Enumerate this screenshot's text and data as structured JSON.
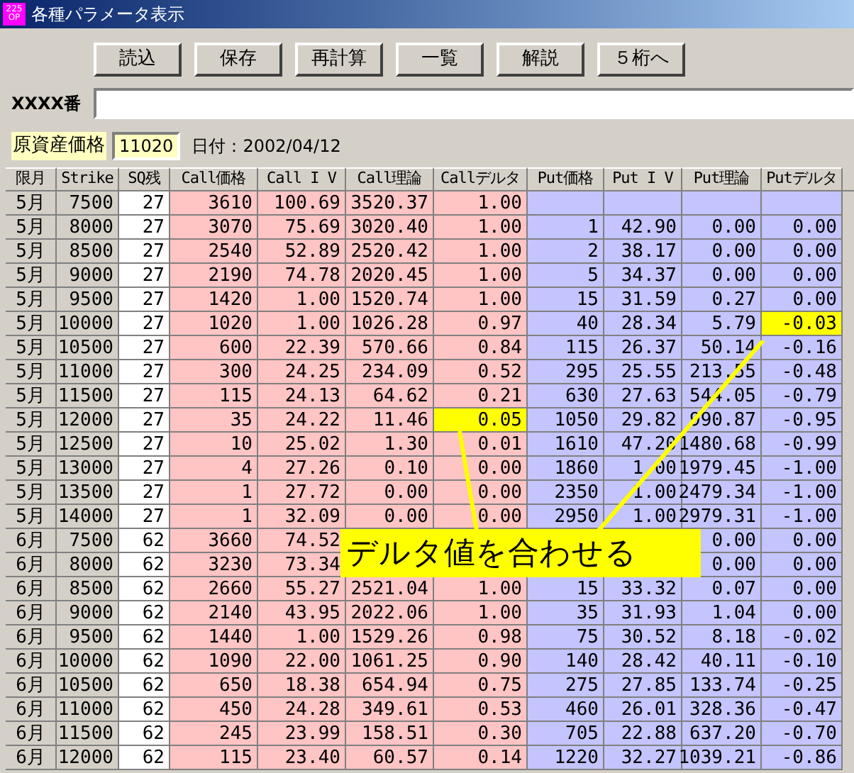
{
  "window": {
    "title": "各種パラメータ表示",
    "icon_lines": [
      "225",
      "OP"
    ]
  },
  "buttons": [
    "読込",
    "保存",
    "再計算",
    "一覧",
    "解説",
    "５桁へ"
  ],
  "code_field": {
    "label": "XXXX番"
  },
  "underlying": {
    "label": "原資産価格",
    "value": "11020",
    "date": "日付：2002/04/12"
  },
  "columns": [
    {
      "label": "限月",
      "kind": "month"
    },
    {
      "label": "Strike",
      "kind": "strike"
    },
    {
      "label": "SQ残",
      "kind": "sq"
    },
    {
      "label": "Call価格",
      "kind": "call"
    },
    {
      "label": "Call I V",
      "kind": "call"
    },
    {
      "label": "Call理論",
      "kind": "call"
    },
    {
      "label": "Callデルタ",
      "kind": "call"
    },
    {
      "label": "Put価格",
      "kind": "put"
    },
    {
      "label": "Put I V",
      "kind": "put"
    },
    {
      "label": "Put理論",
      "kind": "put"
    },
    {
      "label": "Putデルタ",
      "kind": "put"
    }
  ],
  "rows": [
    {
      "cells": [
        "5月",
        "7500",
        "27",
        "3610",
        "100.69",
        "3520.37",
        "1.00",
        null,
        null,
        null,
        null
      ]
    },
    {
      "cells": [
        "5月",
        "8000",
        "27",
        "3070",
        "75.69",
        "3020.40",
        "1.00",
        "1",
        "42.90",
        "0.00",
        "0.00"
      ]
    },
    {
      "cells": [
        "5月",
        "8500",
        "27",
        "2540",
        "52.89",
        "2520.42",
        "1.00",
        "2",
        "38.17",
        "0.00",
        "0.00"
      ]
    },
    {
      "cells": [
        "5月",
        "9000",
        "27",
        "2190",
        "74.78",
        "2020.45",
        "1.00",
        "5",
        "34.37",
        "0.00",
        "0.00"
      ]
    },
    {
      "cells": [
        "5月",
        "9500",
        "27",
        "1420",
        "1.00",
        "1520.74",
        "1.00",
        "15",
        "31.59",
        "0.27",
        "0.00"
      ]
    },
    {
      "cells": [
        "5月",
        "10000",
        "27",
        "1020",
        "1.00",
        "1026.28",
        "0.97",
        "40",
        "28.34",
        "5.79",
        {
          "value": "-0.03",
          "highlighted": true
        }
      ]
    },
    {
      "cells": [
        "5月",
        "10500",
        "27",
        "600",
        "22.39",
        "570.66",
        "0.84",
        "115",
        "26.37",
        "50.14",
        "-0.16"
      ]
    },
    {
      "cells": [
        "5月",
        "11000",
        "27",
        "300",
        "24.25",
        "234.09",
        "0.52",
        "295",
        "25.55",
        "213.55",
        "-0.48"
      ]
    },
    {
      "cells": [
        "5月",
        "11500",
        "27",
        "115",
        "24.13",
        "64.62",
        "0.21",
        "630",
        "27.63",
        "544.05",
        "-0.79"
      ]
    },
    {
      "cells": [
        "5月",
        "12000",
        "27",
        "35",
        "24.22",
        "11.46",
        {
          "value": "0.05",
          "highlighted": true
        },
        "1050",
        "29.82",
        "990.87",
        "-0.95"
      ]
    },
    {
      "cells": [
        "5月",
        "12500",
        "27",
        "10",
        "25.02",
        "1.30",
        "0.01",
        "1610",
        "47.20",
        "1480.68",
        "-0.99"
      ]
    },
    {
      "cells": [
        "5月",
        "13000",
        "27",
        "4",
        "27.26",
        "0.10",
        "0.00",
        "1860",
        "1.00",
        "1979.45",
        "-1.00"
      ]
    },
    {
      "cells": [
        "5月",
        "13500",
        "27",
        "1",
        "27.72",
        "0.00",
        "0.00",
        "2350",
        "1.00",
        "2479.34",
        "-1.00"
      ]
    },
    {
      "cells": [
        "5月",
        "14000",
        "27",
        "1",
        "32.09",
        "0.00",
        "0.00",
        "2950",
        "1.00",
        "2979.31",
        "-1.00"
      ]
    },
    {
      "cells": [
        "6月",
        "7500",
        "62",
        "3660",
        "74.52",
        null,
        null,
        null,
        null,
        "0.00",
        "0.00"
      ]
    },
    {
      "cells": [
        "6月",
        "8000",
        "62",
        "3230",
        "73.34",
        null,
        null,
        null,
        null,
        "0.00",
        "0.00"
      ]
    },
    {
      "cells": [
        "6月",
        "8500",
        "62",
        "2660",
        "55.27",
        "2521.04",
        "1.00",
        "15",
        "33.32",
        "0.07",
        "0.00"
      ]
    },
    {
      "cells": [
        "6月",
        "9000",
        "62",
        "2140",
        "43.95",
        "2022.06",
        "1.00",
        "35",
        "31.93",
        "1.04",
        "0.00"
      ]
    },
    {
      "cells": [
        "6月",
        "9500",
        "62",
        "1440",
        "1.00",
        "1529.26",
        "0.98",
        "75",
        "30.52",
        "8.18",
        "-0.02"
      ]
    },
    {
      "cells": [
        "6月",
        "10000",
        "62",
        "1090",
        "22.00",
        "1061.25",
        "0.90",
        "140",
        "28.42",
        "40.11",
        "-0.10"
      ]
    },
    {
      "cells": [
        "6月",
        "10500",
        "62",
        "650",
        "18.38",
        "654.94",
        "0.75",
        "275",
        "27.85",
        "133.74",
        "-0.25"
      ]
    },
    {
      "cells": [
        "6月",
        "11000",
        "62",
        "450",
        "24.28",
        "349.61",
        "0.53",
        "460",
        "26.01",
        "328.36",
        "-0.47"
      ]
    },
    {
      "cells": [
        "6月",
        "11500",
        "62",
        "245",
        "23.99",
        "158.51",
        "0.30",
        "705",
        "22.88",
        "637.20",
        "-0.70"
      ]
    },
    {
      "cells": [
        "6月",
        "12000",
        "62",
        "115",
        "23.40",
        "60.57",
        "0.14",
        "1220",
        "32.27",
        "1039.21",
        "-0.86"
      ]
    }
  ],
  "callout": {
    "text": "デルタ値を合わせる"
  }
}
